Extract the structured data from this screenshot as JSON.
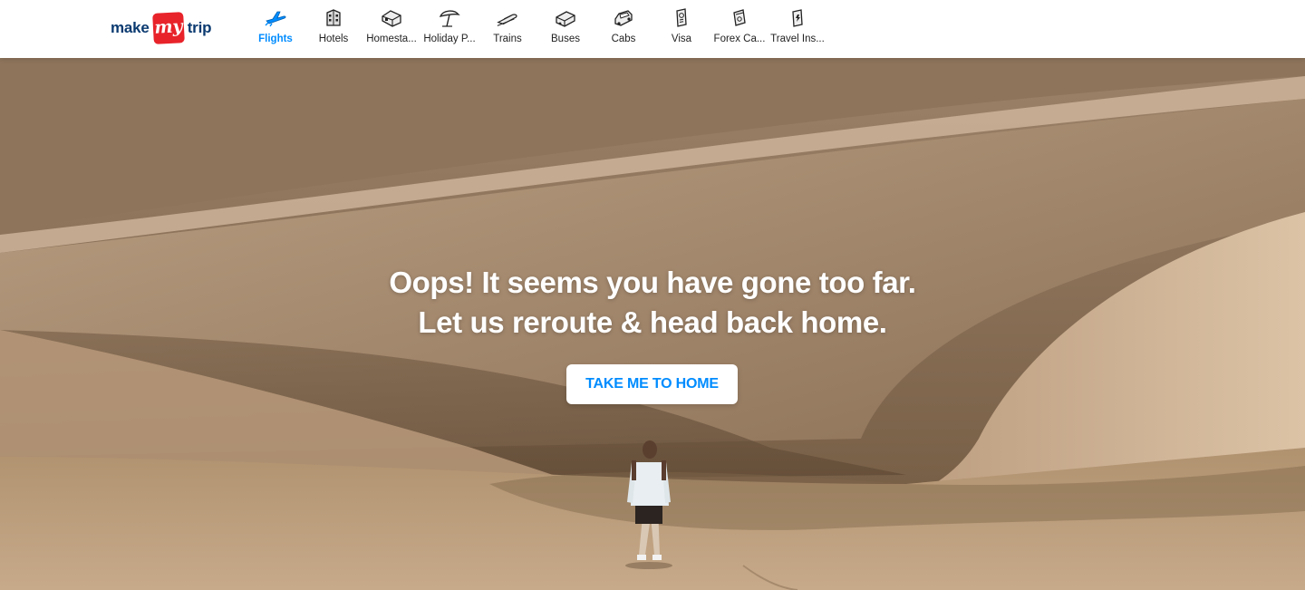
{
  "brand": {
    "logo_make": "make",
    "logo_my": "my",
    "logo_trip": "trip",
    "logo_red": "#e8232a",
    "logo_blue": "#0a3a70"
  },
  "nav": {
    "items": [
      {
        "label": "Flights",
        "icon": "plane-icon",
        "active": true
      },
      {
        "label": "Hotels",
        "icon": "hotel-icon",
        "active": false
      },
      {
        "label": "Homesta...",
        "icon": "homestay-icon",
        "active": false
      },
      {
        "label": "Holiday P...",
        "icon": "holiday-umbrella-icon",
        "active": false
      },
      {
        "label": "Trains",
        "icon": "train-icon",
        "active": false
      },
      {
        "label": "Buses",
        "icon": "bus-icon",
        "active": false
      },
      {
        "label": "Cabs",
        "icon": "cab-icon",
        "active": false
      },
      {
        "label": "Visa",
        "icon": "visa-passport-icon",
        "active": false
      },
      {
        "label": "Forex Ca...",
        "icon": "forex-card-icon",
        "active": false
      },
      {
        "label": "Travel Ins...",
        "icon": "travel-insurance-icon",
        "active": false
      }
    ],
    "active_color": "#008cff"
  },
  "hero": {
    "headline_line1": "Oops! It seems you have gone too far.",
    "headline_line2": "Let us reroute & head back home.",
    "button_label": "TAKE ME TO HOME",
    "button_text_color": "#008cff",
    "background_image": "desert-dunes-with-lone-traveler"
  }
}
